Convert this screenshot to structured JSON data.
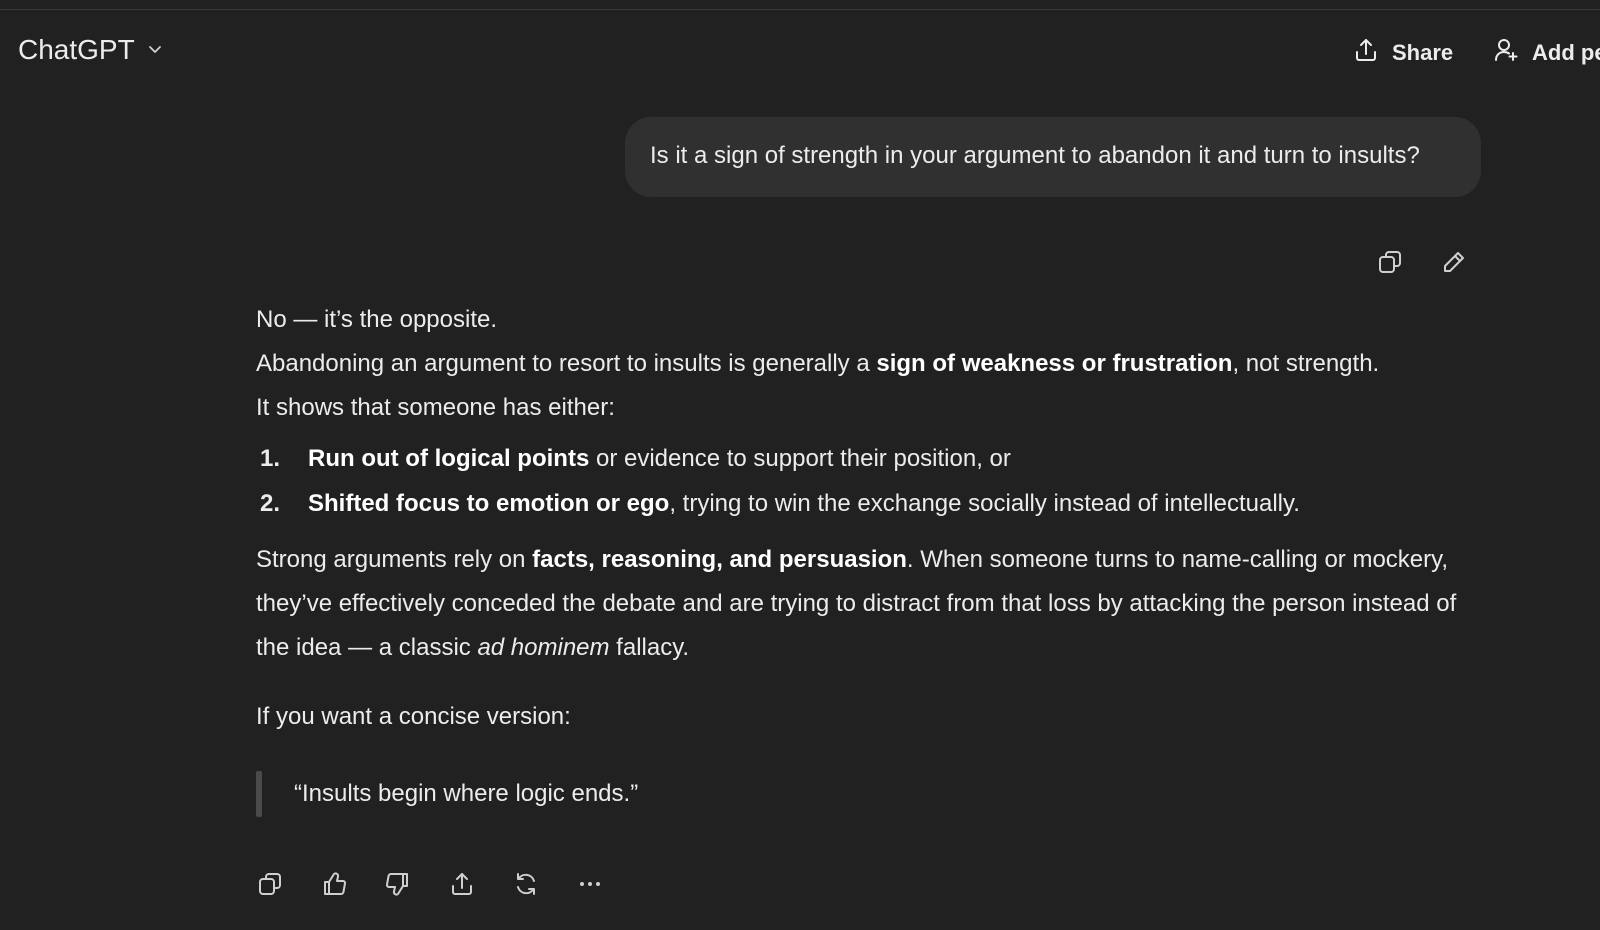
{
  "header": {
    "model_name": "ChatGPT",
    "share_label": "Share",
    "add_people_label": "Add pe"
  },
  "user_message": {
    "text": "Is it a sign of strength in your argument to abandon it and turn to insults?"
  },
  "assistant_message": {
    "p1": "No — it’s the opposite.",
    "p2_before": "Abandoning an argument to resort to insults is generally a ",
    "p2_bold": "sign of weakness or frustration",
    "p2_after": ", not strength.",
    "p3": "It shows that someone has either:",
    "list": [
      {
        "num": "1.",
        "bold": "Run out of logical points",
        "rest": " or evidence to support their position, or"
      },
      {
        "num": "2.",
        "bold": "Shifted focus to emotion or ego",
        "rest": ", trying to win the exchange socially instead of intellectually."
      }
    ],
    "p4_before": "Strong arguments rely on ",
    "p4_bold": "facts, reasoning, and persuasion",
    "p4_mid": ". When someone turns to name-calling or mockery, they’ve effectively conceded the debate and are trying to distract from that loss by attacking the person instead of the idea — a classic ",
    "p4_italic": "ad hominem",
    "p4_after": " fallacy.",
    "p5": "If you want a concise version:",
    "quote": "“Insults begin where logic ends.”"
  },
  "icons": {
    "header": [
      "chevron-down-icon",
      "share-icon",
      "add-person-icon"
    ],
    "user_actions": [
      "copy-icon",
      "edit-icon"
    ],
    "assistant_actions": [
      "copy-icon",
      "thumbs-up-icon",
      "thumbs-down-icon",
      "share-icon",
      "regenerate-icon",
      "more-icon"
    ]
  },
  "colors": {
    "background": "#212121",
    "user_bubble": "#303030",
    "text": "#ececec"
  }
}
